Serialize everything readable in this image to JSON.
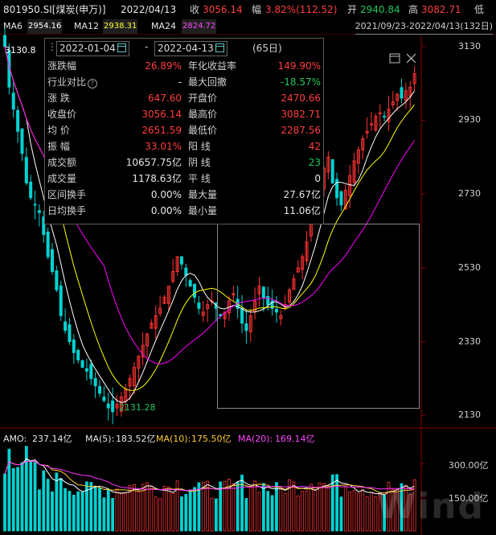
{
  "header": {
    "code_name": "801950.SI[煤炭(申万)]",
    "date": "2022/04/13",
    "close_label": "收",
    "close_value": "3056.14",
    "change_label": "幅",
    "change_value": "3.82%(112.52)",
    "open_label": "开",
    "open_value": "2940.84",
    "high_label": "高",
    "high_value": "3082.71",
    "low_label": "低"
  },
  "ma_bar": {
    "ma6_label": "MA6",
    "ma6_value": "2954.16",
    "ma12_label": "MA12",
    "ma12_value": "2938.31",
    "ma24_label": "MA24",
    "ma24_value": "2824.72",
    "range_text": "2021/09/23-2022/04/13(132日)"
  },
  "panel": {
    "start_date": "2022-01-04",
    "end_date": "2022-04-13",
    "separator": "-",
    "days": "(65日)",
    "rows": [
      {
        "l1": "涨跌幅",
        "v1": "26.89%",
        "c1": "red",
        "l2": "年化收益率",
        "v2": "149.90%",
        "c2": "red"
      },
      {
        "l1": "行业对比",
        "v1": "-",
        "c1": "white",
        "l2": "最大回撤",
        "v2": "-18.57%",
        "c2": "green"
      },
      {
        "l1": "涨  跌",
        "v1": "647.60",
        "c1": "red",
        "l2": "开盘价",
        "v2": "2470.66",
        "c2": "red"
      },
      {
        "l1": "收盘价",
        "v1": "3056.14",
        "c1": "red",
        "l2": "最高价",
        "v2": "3082.71",
        "c2": "red"
      },
      {
        "l1": "均  价",
        "v1": "2651.59",
        "c1": "red",
        "l2": "最低价",
        "v2": "2287.56",
        "c2": "red"
      },
      {
        "l1": "振  幅",
        "v1": "33.01%",
        "c1": "red",
        "l2": "阳  线",
        "v2": "42",
        "c2": "red"
      },
      {
        "l1": "成交额",
        "v1": "10657.75亿",
        "c1": "white",
        "l2": "阴  线",
        "v2": "23",
        "c2": "green"
      },
      {
        "l1": "成交量",
        "v1": "1178.63亿",
        "c1": "white",
        "l2": "平  线",
        "v2": "0",
        "c2": "white"
      },
      {
        "l1": "区间换手",
        "v1": "0.00%",
        "c1": "white",
        "l2": "最大量",
        "v2": "27.67亿",
        "c2": "white"
      },
      {
        "l1": "日均换手",
        "v1": "0.00%",
        "c1": "white",
        "l2": "最小量",
        "v2": "11.06亿",
        "c2": "white"
      }
    ]
  },
  "price_axis": {
    "ticks": [
      "3130",
      "2930",
      "2730",
      "2530",
      "2330",
      "2130"
    ],
    "tick_values": [
      3130,
      2930,
      2730,
      2530,
      2330,
      2130
    ],
    "range": [
      2100,
      3160
    ],
    "max_marker": "3130.8",
    "min_marker": "2131.28"
  },
  "amo_bar": {
    "amo_label": "AMO:",
    "amo_value": "237.14亿",
    "ma5_label": "MA(5):",
    "ma5_value": "183.52亿",
    "ma10_label": "MA(10):",
    "ma10_value": "175.50亿",
    "ma20_label": "MA(20):",
    "ma20_value": "169.14亿"
  },
  "volume_axis": {
    "ticks": [
      "300.00亿",
      "150.00亿"
    ],
    "tick_values": [
      300,
      150
    ],
    "range": [
      0,
      360
    ]
  },
  "watermark": "Wind",
  "colors": {
    "up": "#ff3333",
    "down": "#00d2d2",
    "ma6": "#ffffff",
    "ma12": "#ffff00",
    "ma24": "#ff00ff",
    "amo_ma10": "#ffcc33",
    "amo_ma20": "#ff33ff"
  },
  "chart_data": {
    "type": "candlestick",
    "series_name": "801950.SI",
    "close_approx": [
      3130,
      3020,
      2960,
      2900,
      2840,
      2760,
      2720,
      2700,
      2680,
      2620,
      2560,
      2520,
      2470,
      2400,
      2360,
      2330,
      2300,
      2280,
      2260,
      2250,
      2230,
      2210,
      2190,
      2170,
      2150,
      2140,
      2160,
      2180,
      2200,
      2230,
      2260,
      2290,
      2320,
      2350,
      2380,
      2400,
      2420,
      2450,
      2480,
      2520,
      2560,
      2540,
      2510,
      2480,
      2450,
      2420,
      2410,
      2430,
      2440,
      2420,
      2400,
      2410,
      2440,
      2460,
      2420,
      2380,
      2360,
      2400,
      2440,
      2480,
      2450,
      2430,
      2420,
      2410,
      2400,
      2430,
      2470,
      2500,
      2530,
      2560,
      2600,
      2650,
      2700,
      2760,
      2800,
      2830,
      2760,
      2720,
      2700,
      2740,
      2780,
      2820,
      2850,
      2880,
      2900,
      2920,
      2940,
      2950,
      2940,
      2960,
      2980,
      3000,
      2990,
      3010,
      3020,
      3056
    ]
  }
}
